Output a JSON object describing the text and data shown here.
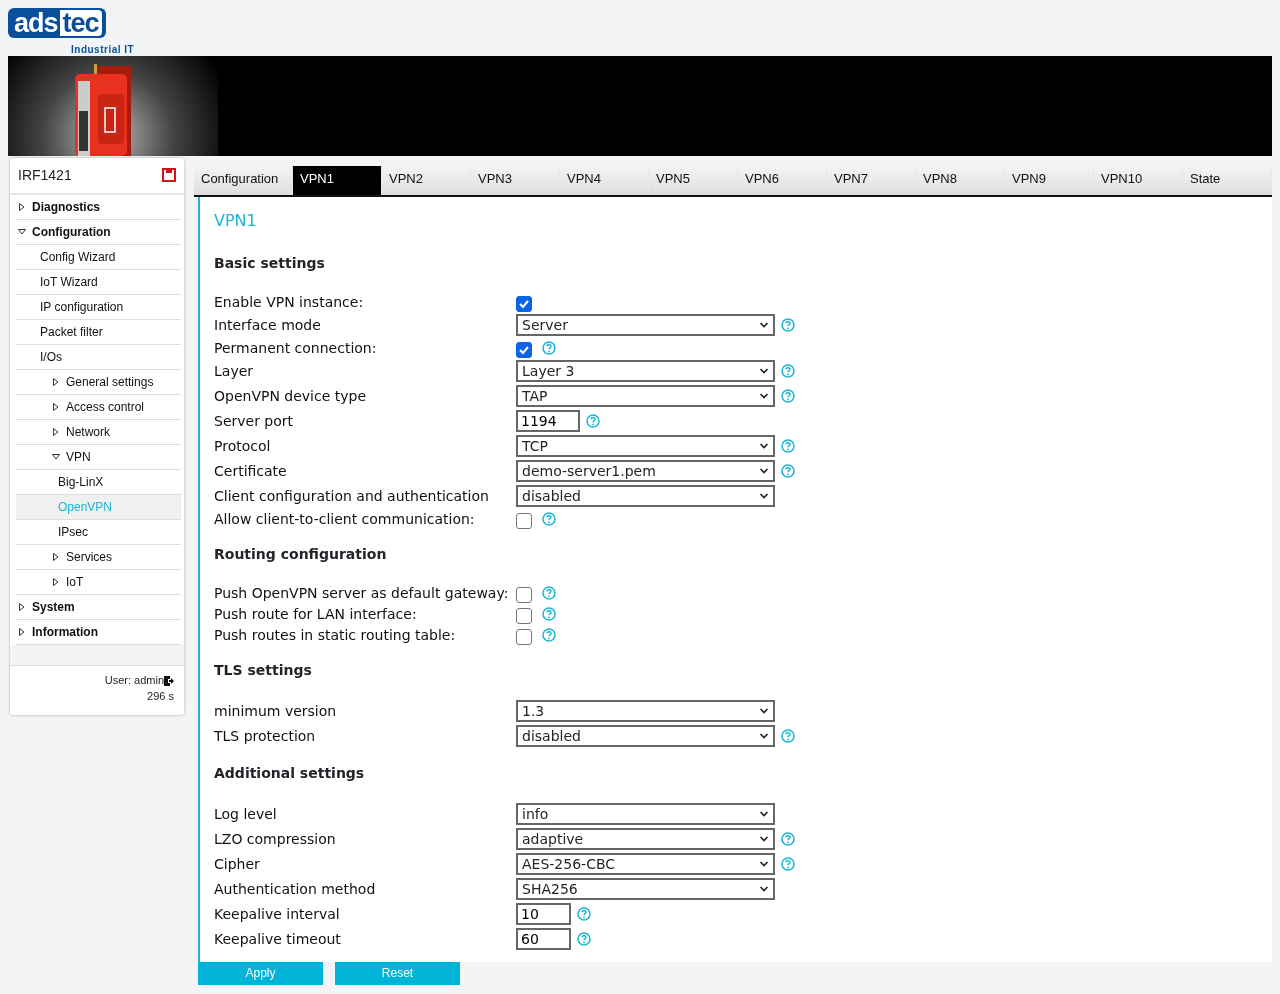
{
  "logo": {
    "name": "adstec",
    "tagline": "Industrial IT"
  },
  "banner": {
    "kind": "picture"
  },
  "sidebar": {
    "title": "IRF1421",
    "items": [
      {
        "label": "Diagnostics",
        "kind": "folder",
        "expanded": false,
        "selected": false
      },
      {
        "label": "Configuration",
        "kind": "folder",
        "expanded": true,
        "selected": false,
        "children": [
          {
            "label": "Config Wizard",
            "kind": "page",
            "selected": false
          },
          {
            "label": "IoT Wizard",
            "kind": "page",
            "selected": false
          },
          {
            "label": "IP configuration",
            "kind": "page",
            "selected": false
          },
          {
            "label": "Packet filter",
            "kind": "page",
            "selected": false
          },
          {
            "label": "I/Os",
            "kind": "page",
            "selected": false
          },
          {
            "label": "General settings",
            "kind": "folder",
            "expanded": false,
            "selected": false
          },
          {
            "label": "Access control",
            "kind": "folder",
            "expanded": false,
            "selected": false
          },
          {
            "label": "Network",
            "kind": "folder",
            "expanded": false,
            "selected": false
          },
          {
            "label": "VPN",
            "kind": "folder",
            "expanded": true,
            "selected": false,
            "children": [
              {
                "label": "Big-LinX",
                "kind": "page",
                "selected": false
              },
              {
                "label": "OpenVPN",
                "kind": "page",
                "selected": true
              },
              {
                "label": "IPsec",
                "kind": "page",
                "selected": false
              }
            ]
          },
          {
            "label": "Services",
            "kind": "folder",
            "expanded": false,
            "selected": false
          },
          {
            "label": "IoT",
            "kind": "folder",
            "expanded": false,
            "selected": false
          }
        ]
      },
      {
        "label": "System",
        "kind": "folder",
        "expanded": false,
        "selected": false
      },
      {
        "label": "Information",
        "kind": "folder",
        "expanded": false,
        "selected": false
      }
    ],
    "user": "User: admin",
    "timer": "296 s"
  },
  "tabs": [
    {
      "label": "Configuration",
      "selected": false
    },
    {
      "label": "VPN1",
      "selected": true
    },
    {
      "label": "VPN2",
      "selected": false
    },
    {
      "label": "VPN3",
      "selected": false
    },
    {
      "label": "VPN4",
      "selected": false
    },
    {
      "label": "VPN5",
      "selected": false
    },
    {
      "label": "VPN6",
      "selected": false
    },
    {
      "label": "VPN7",
      "selected": false
    },
    {
      "label": "VPN8",
      "selected": false
    },
    {
      "label": "VPN9",
      "selected": false
    },
    {
      "label": "VPN10",
      "selected": false
    },
    {
      "label": "State",
      "selected": false
    }
  ],
  "heading": "VPN1",
  "sections": [
    {
      "title": "Basic settings",
      "rows": [
        {
          "label": "Enable VPN instance:",
          "kind": "checkbox",
          "checked": true,
          "help": false
        },
        {
          "label": "Interface mode",
          "kind": "select",
          "value": "Server",
          "help": true
        },
        {
          "label": "Permanent connection:",
          "kind": "checkbox",
          "checked": true,
          "help": true
        },
        {
          "label": "Layer",
          "kind": "select",
          "value": "Layer 3",
          "help": true
        },
        {
          "label": "OpenVPN device type",
          "kind": "select",
          "value": "TAP",
          "help": true
        },
        {
          "label": "Server port",
          "kind": "text",
          "value": "1194",
          "help": true
        },
        {
          "label": "Protocol",
          "kind": "select",
          "value": "TCP",
          "help": true
        },
        {
          "label": "Certificate",
          "kind": "select",
          "value": "demo-server1.pem",
          "help": true
        },
        {
          "label": "Client configuration and authentication",
          "kind": "select",
          "value": "disabled",
          "help": false
        },
        {
          "label": "Allow client-to-client communication:",
          "kind": "checkbox",
          "checked": false,
          "help": true
        }
      ]
    },
    {
      "title": "Routing configuration",
      "rows": [
        {
          "label": "Push OpenVPN server as default gateway:",
          "kind": "checkbox",
          "checked": false,
          "help": true
        },
        {
          "label": "Push route for LAN interface:",
          "kind": "checkbox",
          "checked": false,
          "help": true
        },
        {
          "label": "Push routes in static routing table:",
          "kind": "checkbox",
          "checked": false,
          "help": true
        }
      ]
    },
    {
      "title": "TLS settings",
      "rows": [
        {
          "label": "minimum version",
          "kind": "select",
          "value": "1.3",
          "help": false
        },
        {
          "label": "TLS protection",
          "kind": "select",
          "value": "disabled",
          "help": true
        }
      ]
    },
    {
      "title": "Additional settings",
      "rows": [
        {
          "label": "Log level",
          "kind": "select",
          "value": "info",
          "help": false
        },
        {
          "label": "LZO compression",
          "kind": "select",
          "value": "adaptive",
          "help": true
        },
        {
          "label": "Cipher",
          "kind": "select",
          "value": "AES-256-CBC",
          "help": true
        },
        {
          "label": "Authentication method",
          "kind": "select",
          "value": "SHA256",
          "help": false
        },
        {
          "label": "Keepalive interval",
          "kind": "short",
          "value": "10",
          "help": true
        },
        {
          "label": "Keepalive timeout",
          "kind": "short",
          "value": "60",
          "help": true
        }
      ]
    }
  ],
  "buttons": [
    "Apply",
    "Reset"
  ]
}
